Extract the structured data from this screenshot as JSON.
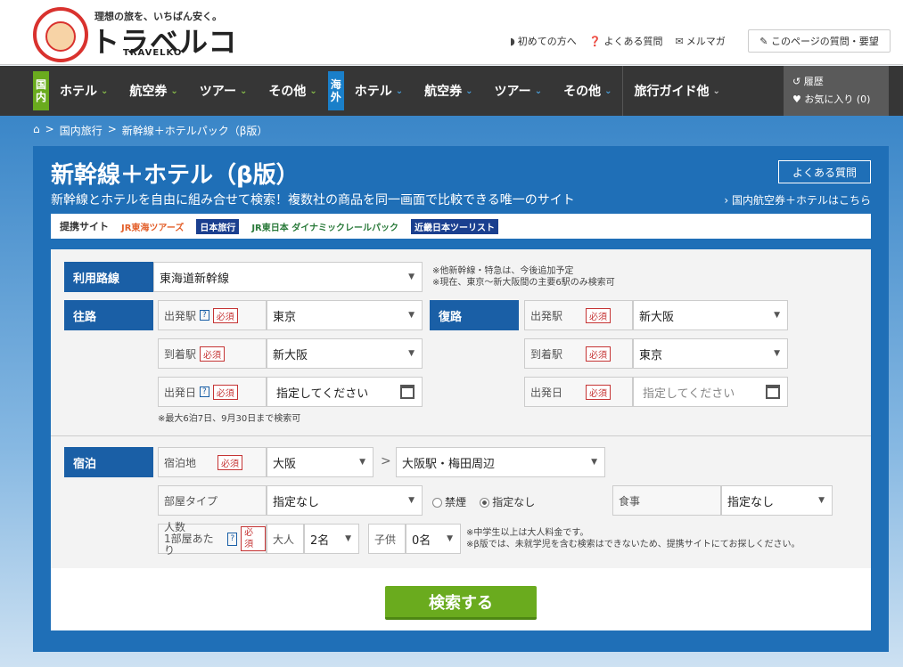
{
  "header": {
    "tagline": "理想の旅を、いちばん安く。",
    "logo_text": "トラベルコ",
    "logo_sub": "TRAVELKO",
    "links": [
      "初めての方へ",
      "よくある質問",
      "メルマガ"
    ],
    "page_question_btn": "このページの質問・要望"
  },
  "nav": {
    "domestic_badge": "国内",
    "overseas_badge": "海外",
    "domestic_items": [
      "ホテル",
      "航空券",
      "ツアー",
      "その他"
    ],
    "overseas_items": [
      "ホテル",
      "航空券",
      "ツアー",
      "その他"
    ],
    "guide": "旅行ガイド他",
    "history": "履歴",
    "favorites": "お気に入り (0)"
  },
  "breadcrumb": [
    "国内旅行",
    "新幹線＋ホテルパック（β版）"
  ],
  "panel": {
    "title": "新幹線＋ホテル（β版）",
    "subtitle": "新幹線とホテルを自由に組み合せて検索！複数社の商品を同一画面で比較できる唯一のサイト",
    "faq": "よくある質問",
    "domestic_link": "国内航空券＋ホテルはこちら",
    "partners_label": "提携サイト",
    "partners": [
      "JR東海ツアーズ",
      "日本旅行",
      "JR東日本 ダイナミックレールパック",
      "近畿日本ツーリスト"
    ]
  },
  "form": {
    "route_label": "利用路線",
    "route_value": "東海道新幹線",
    "route_note1": "※他新幹線・特急は、今後追加予定",
    "route_note2": "※現在、東京～新大阪間の主要6駅のみ検索可",
    "outbound_label": "往路",
    "return_label": "復路",
    "depart_station": "出発駅",
    "arrive_station": "到着駅",
    "depart_date": "出発日",
    "required": "必須",
    "help": "?",
    "out_from": "東京",
    "out_to": "新大阪",
    "out_date_placeholder": "指定してください",
    "ret_from": "新大阪",
    "ret_to": "東京",
    "ret_date_placeholder": "指定してください",
    "date_note": "※最大6泊7日、9月30日まで検索可",
    "stay_label": "宿泊",
    "stay_place": "宿泊地",
    "stay_area": "大阪",
    "stay_subarea": "大阪駅・梅田周辺",
    "room_type": "部屋タイプ",
    "room_value": "指定なし",
    "smoke_no": "禁煙",
    "smoke_any": "指定なし",
    "meal": "食事",
    "meal_value": "指定なし",
    "people": "人数",
    "per_room": "1部屋あたり",
    "adult": "大人",
    "adult_value": "2名",
    "child": "子供",
    "child_value": "0名",
    "people_note1": "※中学生以上は大人料金です。",
    "people_note2": "※β版では、未就学児を含む検索はできないため、提携サイトにてお探しください。",
    "search_btn": "検索する"
  }
}
